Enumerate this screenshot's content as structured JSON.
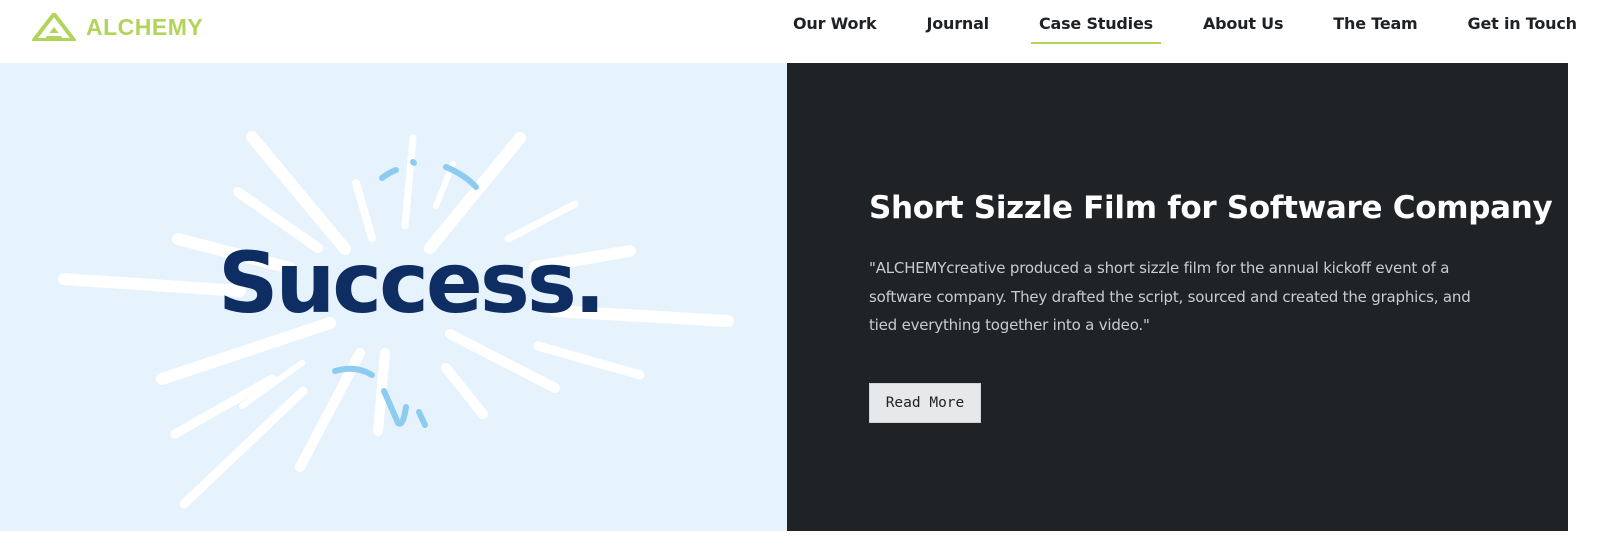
{
  "brand": {
    "name": "ALCHEMY",
    "color": "#b3d45a"
  },
  "nav": {
    "items": [
      {
        "label": "Our Work"
      },
      {
        "label": "Journal"
      },
      {
        "label": "Case Studies",
        "active": true
      },
      {
        "label": "About Us"
      },
      {
        "label": "The Team"
      },
      {
        "label": "Get in Touch"
      }
    ],
    "active_color": "#b3d45a"
  },
  "hero": {
    "image_text": "Success.",
    "image_text_color": "#0d2d63",
    "image_bg": "#e7f3fc",
    "title": "Short Sizzle Film for Software Company",
    "description": "\"ALCHEMYcreative produced a short sizzle film for the annual kickoff event of a software company. They drafted the script, sourced and created the graphics, and tied everything together into a video.\"",
    "button_label": "Read More",
    "panel_bg": "#202326"
  }
}
